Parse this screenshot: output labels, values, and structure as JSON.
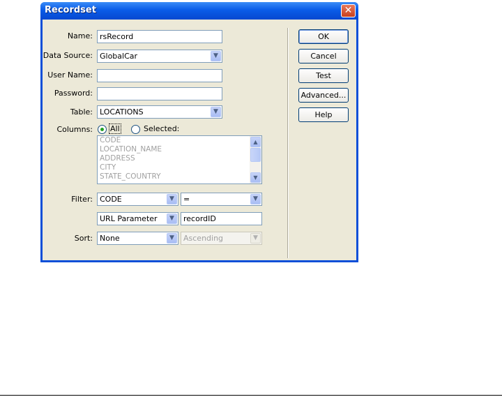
{
  "window": {
    "title": "Recordset",
    "close_glyph": "✕"
  },
  "form": {
    "name_label": "Name:",
    "name_value": "rsRecord",
    "datasource_label": "Data Source:",
    "datasource_value": "GlobalCar",
    "username_label": "User Name:",
    "username_value": "",
    "password_label": "Password:",
    "password_value": "",
    "table_label": "Table:",
    "table_value": "LOCATIONS",
    "columns_label": "Columns:",
    "columns_all_label": "All",
    "columns_selected_label": "Selected:",
    "columns_selected_option": "All",
    "columns_list": [
      "CODE",
      "LOCATION_NAME",
      "ADDRESS",
      "CITY",
      "STATE_COUNTRY"
    ],
    "filter_label": "Filter:",
    "filter_column": "CODE",
    "filter_operator": "=",
    "filter_source": "URL Parameter",
    "filter_value": "recordID",
    "sort_label": "Sort:",
    "sort_column": "None",
    "sort_order": "Ascending"
  },
  "buttons": {
    "ok": "OK",
    "cancel": "Cancel",
    "test": "Test",
    "advanced": "Advanced...",
    "help": "Help"
  },
  "icons": {
    "dropdown_arrow": "▼",
    "scroll_up": "▲",
    "scroll_down": "▼"
  },
  "colors": {
    "titlebar": "#0a5ce8",
    "dialog_bg": "#ece9d8",
    "close_button": "#c9401d"
  }
}
